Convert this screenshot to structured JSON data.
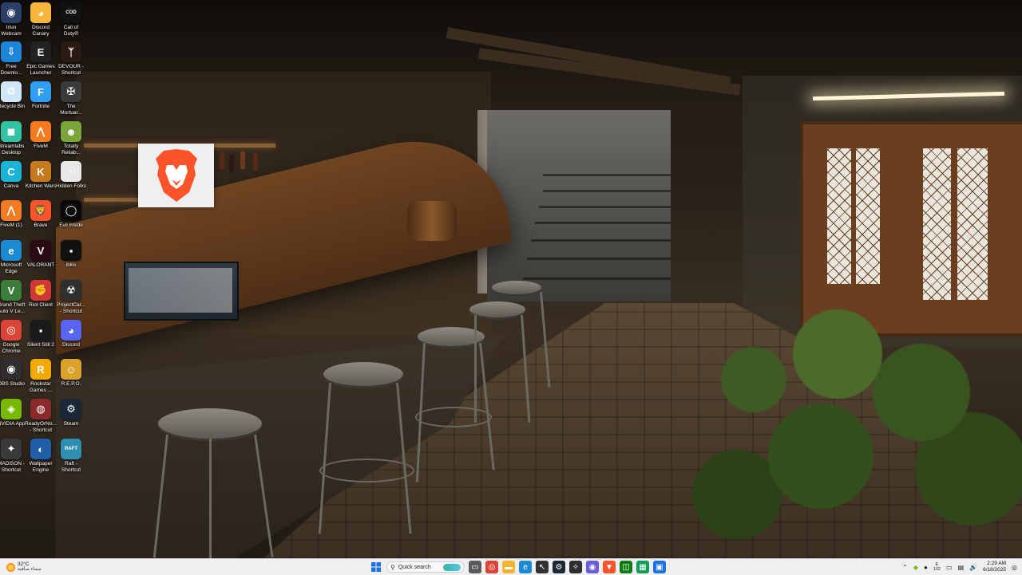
{
  "desktop_icons": [
    {
      "name": "irium-webcam",
      "label": "Iriun\nWebcam",
      "glyph": "◉",
      "color": "#2a3e66"
    },
    {
      "name": "discord-canary",
      "label": "Discord\nCanary",
      "glyph": "◕",
      "color": "#f6b73c"
    },
    {
      "name": "call-of-duty",
      "label": "Call of\nDuty®",
      "glyph": "COD",
      "color": "#111111"
    },
    {
      "name": "free-download",
      "label": "Free\nDownlo...",
      "glyph": "⇩",
      "color": "#1d86d6"
    },
    {
      "name": "epic-games-launcher",
      "label": "Epic Games\nLauncher",
      "glyph": "E",
      "color": "#222222"
    },
    {
      "name": "devour",
      "label": "DEVOUR -\nShortcut",
      "glyph": "ᛉ",
      "color": "#2b1a14"
    },
    {
      "name": "recycle-bin",
      "label": "Recycle Bin",
      "glyph": "♻",
      "color": "#cfe7f7"
    },
    {
      "name": "fortnite",
      "label": "Fortnite",
      "glyph": "F",
      "color": "#2e9df2"
    },
    {
      "name": "the-mortuary",
      "label": "The\nMortuar...",
      "glyph": "✠",
      "color": "#3a3a3a"
    },
    {
      "name": "streamlabs-desktop",
      "label": "Streamlabs\nDesktop",
      "glyph": "◼",
      "color": "#31c3a2"
    },
    {
      "name": "fivem",
      "label": "FiveM",
      "glyph": "⋀",
      "color": "#f47b20"
    },
    {
      "name": "totally-reliable",
      "label": "Totally\nReliab...",
      "glyph": "☻",
      "color": "#7aa53a"
    },
    {
      "name": "canva",
      "label": "Canva",
      "glyph": "C",
      "color": "#19b4d6"
    },
    {
      "name": "kitchen-wars",
      "label": "Kitchen Wars",
      "glyph": "K",
      "color": "#c7791e"
    },
    {
      "name": "hidden-folks",
      "label": "Hidden Folks",
      "glyph": "☉",
      "color": "#e8e8e8"
    },
    {
      "name": "fivem-1",
      "label": "FiveM (1)",
      "glyph": "⋀",
      "color": "#f47b20"
    },
    {
      "name": "brave",
      "label": "Brave",
      "glyph": "🦁",
      "color": "#fb542b"
    },
    {
      "name": "evil-inside",
      "label": "Evil Inside",
      "glyph": "◯",
      "color": "#0b0b0b"
    },
    {
      "name": "microsoft-edge",
      "label": "Microsoft\nEdge",
      "glyph": "e",
      "color": "#1a8ad4"
    },
    {
      "name": "valorant",
      "label": "VALORANT",
      "glyph": "V",
      "color": "#2b0b16"
    },
    {
      "name": "ibilis",
      "label": "ibilis",
      "glyph": "▪",
      "color": "#111111"
    },
    {
      "name": "gta-v",
      "label": "Grand Theft\nAuto V Le...",
      "glyph": "V",
      "color": "#3b7d3a"
    },
    {
      "name": "riot-client",
      "label": "Riot Client",
      "glyph": "✊",
      "color": "#d13639"
    },
    {
      "name": "project-car",
      "label": "ProjectCar...\n- Shortcut",
      "glyph": "☢",
      "color": "#2f2f2f"
    },
    {
      "name": "google-chrome",
      "label": "Google\nChrome",
      "glyph": "◎",
      "color": "#db4437"
    },
    {
      "name": "silent-still-2",
      "label": "Silent Still 2",
      "glyph": "▪",
      "color": "#1a1a1a"
    },
    {
      "name": "discord",
      "label": "Discord",
      "glyph": "◕",
      "color": "#5865f2"
    },
    {
      "name": "obs-studio",
      "label": "OBS Studio",
      "glyph": "◉",
      "color": "#302e31"
    },
    {
      "name": "rockstar-games",
      "label": "Rockstar\nGames ...",
      "glyph": "R",
      "color": "#f2a900"
    },
    {
      "name": "repo",
      "label": "R.E.P.O.",
      "glyph": "☺",
      "color": "#d9a32b"
    },
    {
      "name": "nvidia-app",
      "label": "NVIDIA App",
      "glyph": "◈",
      "color": "#76b900"
    },
    {
      "name": "ready-or-not",
      "label": "ReadyOrNo...\n- Shortcut",
      "glyph": "◍",
      "color": "#8a2a2a"
    },
    {
      "name": "steam",
      "label": "Steam",
      "glyph": "⚙",
      "color": "#1b2838"
    },
    {
      "name": "madison",
      "label": "MADiSON -\nShortcut",
      "glyph": "✦",
      "color": "#3a3a3a"
    },
    {
      "name": "wallpaper-engine",
      "label": "Wallpaper\nEngine",
      "glyph": "◐",
      "color": "#1f5fa8"
    },
    {
      "name": "raft",
      "label": "Raft -\nShortcut",
      "glyph": "RAFT",
      "color": "#2f8fb0"
    }
  ],
  "taskbar": {
    "weather_temp": "32°C",
    "weather_condition": "سماء صافية",
    "search_placeholder": "Quick search",
    "pinned_apps": [
      {
        "name": "task-view",
        "glyph": "▭",
        "color": "#5a5a5a"
      },
      {
        "name": "chrome",
        "glyph": "◎",
        "color": "#db4437"
      },
      {
        "name": "file-explorer",
        "glyph": "▬",
        "color": "#f2b431"
      },
      {
        "name": "edge",
        "glyph": "e",
        "color": "#1a8ad4"
      },
      {
        "name": "cursor",
        "glyph": "↖",
        "color": "#333333"
      },
      {
        "name": "steam",
        "glyph": "⚙",
        "color": "#1b2838"
      },
      {
        "name": "xbox",
        "glyph": "✧",
        "color": "#2f2f2f"
      },
      {
        "name": "obs",
        "glyph": "◉",
        "color": "#6b5bd6"
      },
      {
        "name": "brave",
        "glyph": "▼",
        "color": "#fb542b"
      },
      {
        "name": "xbox-app",
        "glyph": "◫",
        "color": "#107c10"
      },
      {
        "name": "remote",
        "glyph": "▦",
        "color": "#0f9d58"
      },
      {
        "name": "media",
        "glyph": "▣",
        "color": "#1a73e8"
      }
    ],
    "tray": {
      "kbd_top": "E",
      "kbd_bottom": "102",
      "time": "2:29 AM",
      "date": "6/18/2025"
    }
  }
}
